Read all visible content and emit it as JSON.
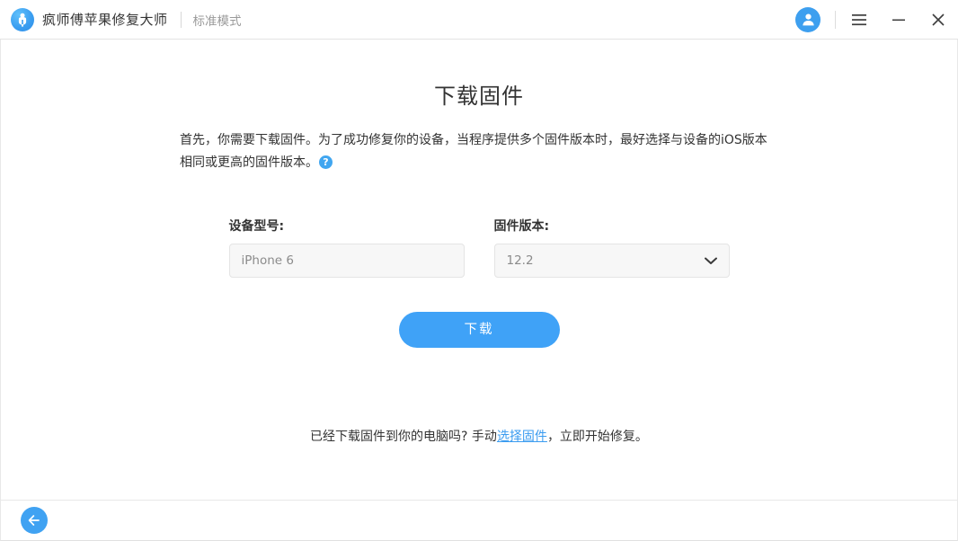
{
  "titlebar": {
    "logo_icon": "app-logo-icon",
    "brand_name": "疯师傅苹果修复大师",
    "mode_label": "标准模式",
    "avatar_icon": "user-avatar-icon",
    "menu_icon": "hamburger-menu-icon",
    "minimize_icon": "minimize-icon",
    "close_icon": "close-icon"
  },
  "main": {
    "page_title": "下载固件",
    "intro_text": "首先，你需要下载固件。为了成功修复你的设备，当程序提供多个固件版本时，最好选择与设备的iOS版本相同或更高的固件版本。",
    "help_glyph": "?",
    "device_field": {
      "label": "设备型号:",
      "value": "iPhone 6"
    },
    "firmware_field": {
      "label": "固件版本:",
      "value": "12.2",
      "chevron_icon": "chevron-down-icon"
    },
    "download_button": "下载",
    "manual": {
      "prefix": "已经下载固件到你的电脑吗? 手动",
      "link": "选择固件",
      "suffix": "，立即开始修复。"
    }
  },
  "footer": {
    "back_icon": "arrow-left-icon"
  },
  "colors": {
    "accent": "#3fa2f7",
    "link": "#3b9cf0",
    "text": "#333333",
    "muted": "#8b8b8b",
    "field_bg": "#f7f7f7",
    "border": "#e4e4e4"
  }
}
